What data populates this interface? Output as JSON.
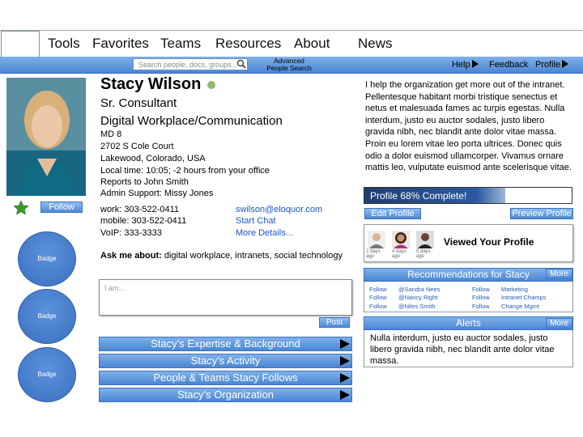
{
  "nav": {
    "items": [
      "Tools",
      "Favorites",
      "Teams",
      "Resources",
      "About",
      "News"
    ]
  },
  "toolbar": {
    "search_placeholder": "Search people, docs, groups...",
    "advanced_line1": "Advanced",
    "advanced_line2": "People Search",
    "help": "Help",
    "feedback": "Feedback",
    "profile": "Profile"
  },
  "profile": {
    "name": "Stacy Wilson",
    "title": "Sr. Consultant",
    "department": "Digital Workplace/Communication",
    "mailstop": "MD 8",
    "street": "2702 S Cole Court",
    "city": "Lakewood, Colorado, USA",
    "local_time": "Local time: 10:05; -2 hours from your office",
    "reports_to": "Reports to John Smith",
    "admin_support": "Admin Support: Missy Jones",
    "work_phone": "work: 303-522-0411",
    "mobile_phone": "mobile: 303-522-0411",
    "voip": "VoIP: 333-3333",
    "email": "swilson@eloquor.com",
    "start_chat": "Start Chat",
    "more_details": "More Details...",
    "ask_me_label": "Ask me about:",
    "ask_me_topics": "digital workplace, intranets, social technology",
    "status_color": "#8fbf6a"
  },
  "left": {
    "follow_label": "Follow",
    "badges": [
      "Badge",
      "Badge",
      "Badge"
    ]
  },
  "comment": {
    "placeholder": "I am...",
    "post_label": "Post"
  },
  "sections": [
    "Stacy’s Expertise & Background",
    "Stacy’s Activity",
    "People & Teams Stacy Follows",
    "Stacy’s Organization"
  ],
  "right": {
    "bio": "I help the organization get more out of the intranet. Pellentesque habitant morbi tristique senectus et netus et malesuada fames ac turpis egestas. Nulla interdum, justo eu auctor sodales, justo libero gravida nibh, nec blandit ante dolor vitae massa. Proin eu lorem vitae leo porta ultrices. Donec quis odio a dolor euismod ullamcorper. Vivamus ornare mattis leo, vulputate euismod ante scelerisque vitae.",
    "profile_complete_text": "Profile 68% Complete!",
    "profile_complete_fraction": 0.68,
    "edit_profile": "Edit Profile",
    "preview_profile": "Preview Profile",
    "viewed_title": "Viewed Your Profile",
    "viewers": [
      {
        "caption": "2 days ago"
      },
      {
        "caption": "4 days ago"
      },
      {
        "caption": "5 days ago"
      }
    ],
    "recommendations_title": "Recommendations for Stacy",
    "more_label": "More",
    "recommendations": [
      {
        "action": "Follow",
        "name": "@Sandra Nees"
      },
      {
        "action": "Follow",
        "name": "@Nancy Right"
      },
      {
        "action": "Follow",
        "name": "@Niles Smith"
      },
      {
        "action": "Follow",
        "name": "Marketing"
      },
      {
        "action": "Follow",
        "name": "Intranet Champs"
      },
      {
        "action": "Follow",
        "name": "Change Mgmt"
      }
    ],
    "alerts_title": "Alerts",
    "alert_text": "Nulla interdum, justo eu auctor sodales, justo libero gravida nibh, nec blandit ante dolor vitae massa."
  }
}
